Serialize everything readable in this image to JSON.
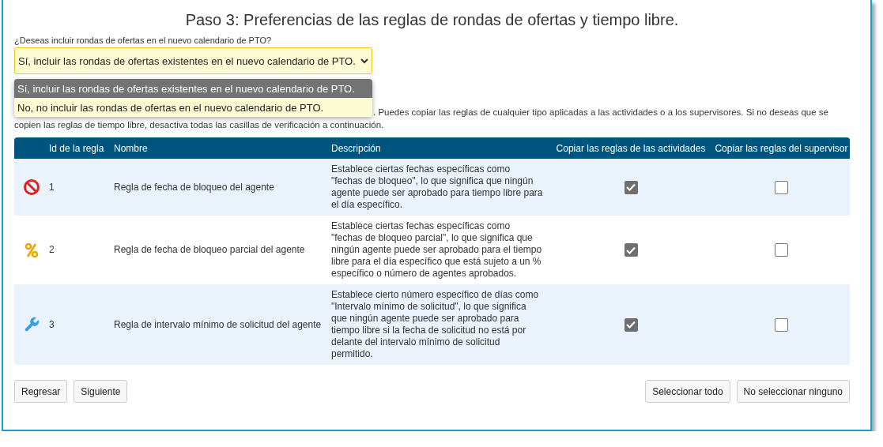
{
  "title": "Paso 3: Preferencias de las reglas de rondas de ofertas y tiempo libre.",
  "question": "¿Deseas incluir rondas de ofertas en el nuevo calendario de PTO?",
  "select": {
    "value": "Sí, incluir las rondas de ofertas existentes en el nuevo calendario de PTO.",
    "options": [
      {
        "label": "Sí, incluir las rondas de ofertas existentes en el nuevo calendario de PTO.",
        "selected": true
      },
      {
        "label": "No, no incluir las rondas de ofertas en el nuevo calendario de PTO.",
        "selected": false
      }
    ]
  },
  "info_lines": [
    ". Puedes copiar las reglas de cualquier tipo aplicadas a las actividades o a los supervisores. Si no deseas que se",
    "copien las reglas de tiempo libre, desactiva todas las casillas de verificación a continuación."
  ],
  "table": {
    "columns": [
      "Id de la regla",
      "Nombre",
      "Descripción",
      "Copiar las reglas de las actividades",
      "Copiar las reglas del supervisor"
    ],
    "rows": [
      {
        "kind": "blocked",
        "id": "1",
        "name": "Regla de fecha de bloqueo del agente",
        "description": "Establece ciertas fechas específicas como \"fechas de bloqueo\", lo que significa que ningún agente puede ser aprobado para tiempo libre para el día específico.",
        "copy_activities": true,
        "copy_supervisor": false
      },
      {
        "kind": "percent",
        "id": "2",
        "name": "Regla de fecha de bloqueo parcial del agente",
        "description": "Establece ciertas fechas específicas como \"fechas de bloqueo parcial\", lo que significa que ningún agente puede ser aprobado para el tiempo libre para el día específico que está sujeto a un % específico o número de agentes aprobados.",
        "copy_activities": true,
        "copy_supervisor": false
      },
      {
        "kind": "wrench",
        "id": "3",
        "name": "Regla de intervalo mínimo de solicitud del agente",
        "description": "Establece cierto número específico de días como \"Intervalo mínimo de solicitud\", lo que significa que ningún agente puede ser aprobado para tiempo libre si la fecha de solicitud no está por delante del intervalo mínimo de solicitud permitido.",
        "copy_activities": true,
        "copy_supervisor": false
      }
    ]
  },
  "buttons_left": [
    "Regresar",
    "Siguiente"
  ],
  "buttons_right": [
    "Seleccionar todo",
    "No seleccionar ninguno"
  ]
}
